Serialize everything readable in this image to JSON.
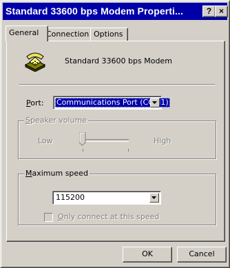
{
  "window": {
    "title": "Standard 33600 bps Modem Properti...",
    "help_label": "?",
    "close_label": "×"
  },
  "tabs": [
    {
      "label": "General",
      "active": true
    },
    {
      "label": "Connection",
      "active": false
    },
    {
      "label": "Options",
      "active": false
    }
  ],
  "general": {
    "modem_name": "Standard 33600 bps Modem",
    "modem_icon": "telephone-modem-icon",
    "port": {
      "label": "Port:",
      "mnemonic": "P",
      "label_rest": "ort:",
      "value": "Communications Port (COM1)"
    },
    "speaker_volume": {
      "title": "Speaker volume",
      "mnemonic": "S",
      "title_rest": "peaker volume",
      "low_label": "Low",
      "high_label": "High",
      "level": 0,
      "enabled": false
    },
    "maximum_speed": {
      "title": "Maximum speed",
      "mnemonic": "M",
      "title_rest": "aximum speed",
      "value": "115200",
      "checkbox_label": "Only connect at this speed",
      "checkbox_mnemonic": "O",
      "checkbox_label_rest": "nly connect at this speed",
      "checked": false,
      "checkbox_enabled": false
    }
  },
  "buttons": {
    "ok": "OK",
    "cancel": "Cancel"
  },
  "colors": {
    "titlebar": "#0000a8",
    "face": "#d4d0c8",
    "selection": "#0000a8"
  }
}
